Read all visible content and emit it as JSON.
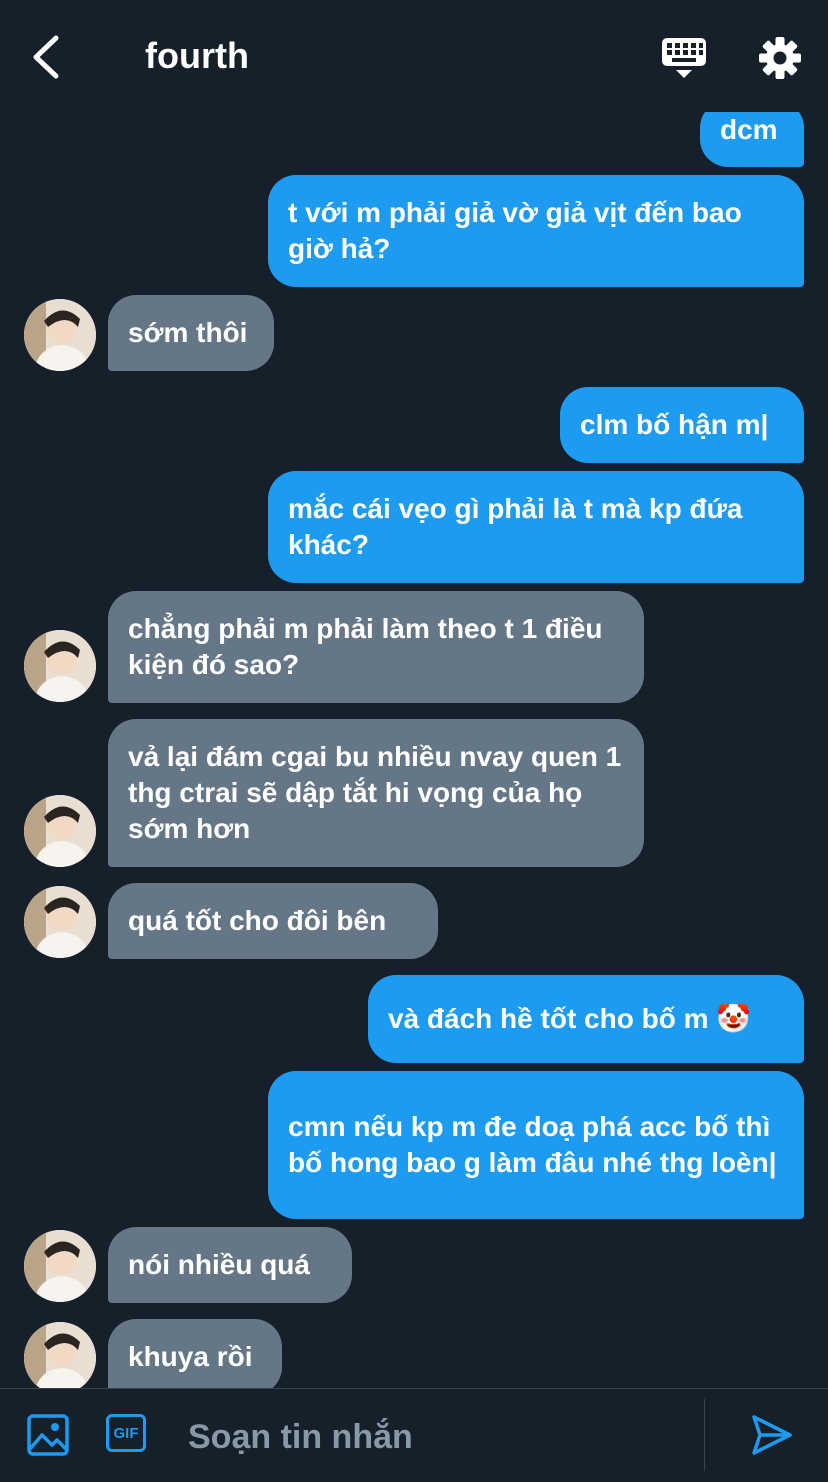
{
  "header": {
    "title": "fourth",
    "back_icon": "chevron-left-icon",
    "keyboard_icon": "keyboard-icon",
    "settings_icon": "gear-icon"
  },
  "colors": {
    "background": "#15202b",
    "sent": "#1d9bf0",
    "received": "#657786",
    "accent": "#1d9bf0"
  },
  "messages": [
    {
      "dir": "sent",
      "text": "dcm"
    },
    {
      "dir": "sent",
      "text": "t với m phải giả vờ giả vịt đến bao giờ hả?"
    },
    {
      "dir": "received",
      "text": "sớm thôi"
    },
    {
      "dir": "sent",
      "text": "clm bố hận m|"
    },
    {
      "dir": "sent",
      "text": "mắc cái vẹo gì phải là t mà kp đứa khác?"
    },
    {
      "dir": "received",
      "text": "chẳng phải m phải làm theo t 1 điều kiện đó sao?"
    },
    {
      "dir": "received",
      "text": "vả lại đám cgai bu nhiều nvay quen 1 thg ctrai sẽ dập tắt hi vọng của họ sớm hơn"
    },
    {
      "dir": "received",
      "text": "quá tốt cho đôi bên"
    },
    {
      "dir": "sent",
      "text": "và đách hề tốt cho bố m 🤡"
    },
    {
      "dir": "sent",
      "text": "cmn nếu kp m đe doạ phá acc bố thì bố hong bao g làm đâu nhé thg loèn|"
    },
    {
      "dir": "received",
      "text": "nói nhiều quá"
    },
    {
      "dir": "received",
      "text": "khuya rồi"
    }
  ],
  "composer": {
    "image_icon": "image-icon",
    "gif_label": "GIF",
    "placeholder": "Soạn tin nhắn",
    "send_icon": "send-icon"
  }
}
